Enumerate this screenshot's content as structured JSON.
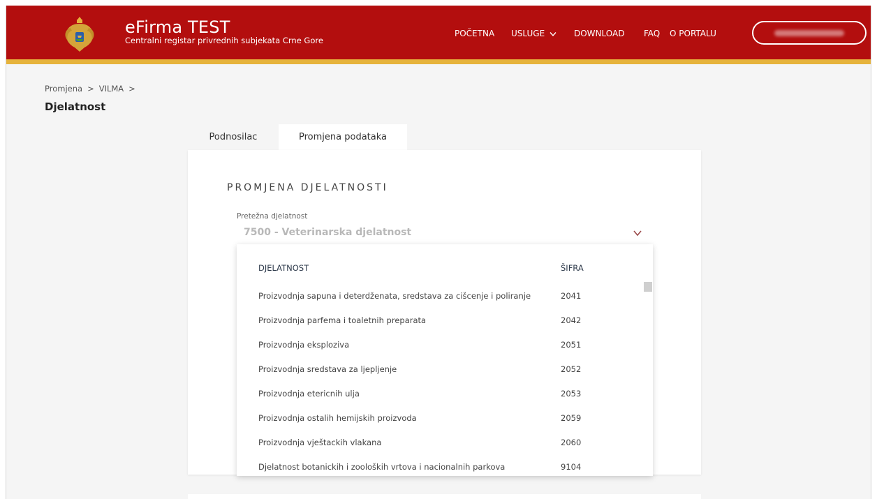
{
  "header": {
    "title": "eFirma TEST",
    "subtitle": "Centralni registar privrednih subjekata Crne Gore",
    "colors": {
      "primary": "#b30e0e",
      "stripe": "#e6b33c"
    },
    "nav": {
      "pocetna": "POČETNA",
      "usluge": "USLUGE",
      "download": "DOWNLOAD",
      "faq": "FAQ",
      "o_portalu": "O PORTALU"
    }
  },
  "breadcrumb": {
    "item1": "Promjena",
    "sep1": ">",
    "item2": "VILMA",
    "sep2": ">"
  },
  "page": {
    "title": "Djelatnost"
  },
  "tabs": {
    "podnosilac": "Podnosilac",
    "promjena": "Promjena podataka"
  },
  "form": {
    "section_title": "PROMJENA DJELATNOSTI",
    "field_label": "Pretežna djelatnost",
    "selected_value": "7500 - Veterinarska djelatnost"
  },
  "dropdown": {
    "col_name": "DJELATNOST",
    "col_code": "ŠIFRA",
    "rows": [
      {
        "name": "Proizvodnja sapuna i deterdženata, sredstava za cišcenje i poliranje",
        "code": "2041"
      },
      {
        "name": "Proizvodnja parfema i toaletnih preparata",
        "code": "2042"
      },
      {
        "name": "Proizvodnja eksploziva",
        "code": "2051"
      },
      {
        "name": "Proizvodnja sredstava za ljepljenje",
        "code": "2052"
      },
      {
        "name": "Proizvodnja etericnih ulja",
        "code": "2053"
      },
      {
        "name": "Proizvodnja ostalih hemijskih proizvoda",
        "code": "2059"
      },
      {
        "name": "Proizvodnja vještackih vlakana",
        "code": "2060"
      },
      {
        "name": "Djelatnost botanickih i zooloških vrtova i nacionalnih parkova",
        "code": "9104"
      }
    ]
  }
}
